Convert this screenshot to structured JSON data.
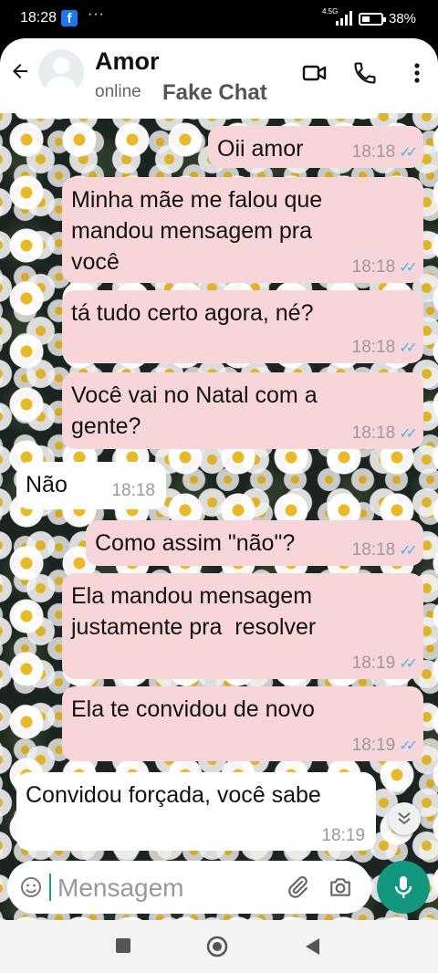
{
  "status_bar": {
    "time": "18:28",
    "app_icon": "facebook-icon",
    "more": "···",
    "network": "4.5G",
    "battery_pct": "38%"
  },
  "header": {
    "contact_name": "Amor",
    "contact_status": "online",
    "watermark": "Fake Chat",
    "icons": [
      "back-arrow-icon",
      "avatar",
      "video-call-icon",
      "phone-icon",
      "more-vert-icon"
    ]
  },
  "messages": [
    {
      "dir": "out",
      "text": "Oii amor",
      "time": "18:18",
      "read": true
    },
    {
      "dir": "out",
      "text": "Minha mãe me falou que\nmandou mensagem pra\nvocê",
      "time": "18:18",
      "read": true
    },
    {
      "dir": "out",
      "text": "tá tudo certo agora, né?",
      "time": "18:18",
      "read": true
    },
    {
      "dir": "out",
      "text": "Você vai no Natal com a\ngente?",
      "time": "18:18",
      "read": true
    },
    {
      "dir": "in",
      "text": "Não",
      "time": "18:18"
    },
    {
      "dir": "out",
      "text": "Como assim \"não\"?",
      "time": "18:18",
      "read": true
    },
    {
      "dir": "out",
      "text": "Ela mandou mensagem\njustamente pra  resolver",
      "time": "18:19",
      "read": true
    },
    {
      "dir": "out",
      "text": "Ela te convidou de novo",
      "time": "18:19",
      "read": true
    },
    {
      "dir": "in",
      "text": "Convidou forçada, você sabe",
      "time": "18:19"
    }
  ],
  "input": {
    "placeholder": "Mensagem"
  },
  "colors": {
    "outgoing_bubble": "#f8d5d8",
    "incoming_bubble": "#ffffff",
    "accent": "#14977f",
    "read_ticks": "#4fb6ec"
  }
}
